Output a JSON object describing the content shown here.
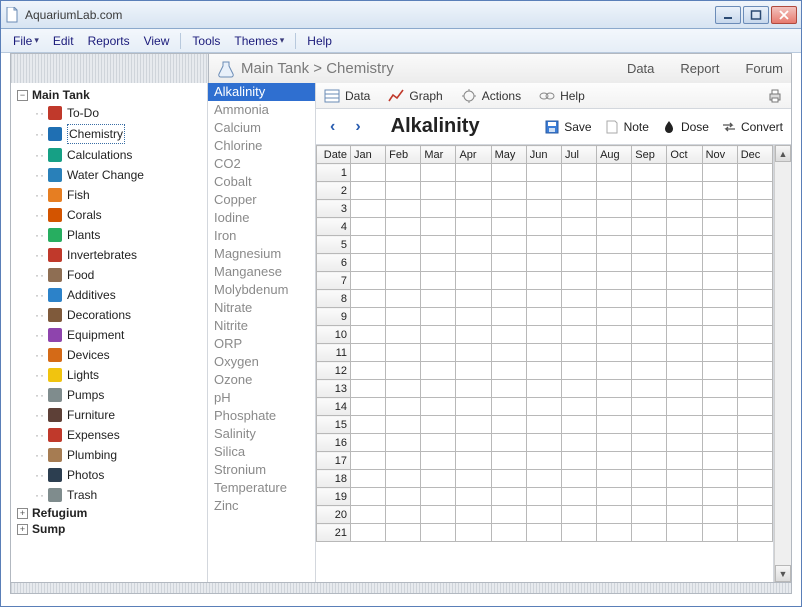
{
  "window": {
    "title": "AquariumLab.com"
  },
  "menubar": {
    "file": "File",
    "edit": "Edit",
    "reports": "Reports",
    "view": "View",
    "tools": "Tools",
    "themes": "Themes",
    "help": "Help"
  },
  "header": {
    "breadcrumb": "Main Tank > Chemistry",
    "links": {
      "data": "Data",
      "report": "Report",
      "forum": "Forum"
    }
  },
  "sidebar": {
    "tanks": [
      {
        "name": "Main Tank",
        "expanded": true
      },
      {
        "name": "Refugium",
        "expanded": false
      },
      {
        "name": "Sump",
        "expanded": false
      }
    ],
    "children": [
      "To-Do",
      "Chemistry",
      "Calculations",
      "Water Change",
      "Fish",
      "Corals",
      "Plants",
      "Invertebrates",
      "Food",
      "Additives",
      "Decorations",
      "Equipment",
      "Devices",
      "Lights",
      "Pumps",
      "Furniture",
      "Expenses",
      "Plumbing",
      "Photos",
      "Trash"
    ],
    "selected_child": "Chemistry"
  },
  "params": {
    "items": [
      "Alkalinity",
      "Ammonia",
      "Calcium",
      "Chlorine",
      "CO2",
      "Cobalt",
      "Copper",
      "Iodine",
      "Iron",
      "Magnesium",
      "Manganese",
      "Molybdenum",
      "Nitrate",
      "Nitrite",
      "ORP",
      "Oxygen",
      "Ozone",
      "pH",
      "Phosphate",
      "Salinity",
      "Silica",
      "Stronium",
      "Temperature",
      "Zinc"
    ],
    "selected": "Alkalinity"
  },
  "toolbar": {
    "data": "Data",
    "graph": "Graph",
    "actions": "Actions",
    "help": "Help"
  },
  "titlebar2": {
    "title": "Alkalinity",
    "save": "Save",
    "note": "Note",
    "dose": "Dose",
    "convert": "Convert"
  },
  "grid": {
    "headers": [
      "Date",
      "Jan",
      "Feb",
      "Mar",
      "Apr",
      "May",
      "Jun",
      "Jul",
      "Aug",
      "Sep",
      "Oct",
      "Nov",
      "Dec"
    ],
    "row_start": 1,
    "row_end": 21
  },
  "icons": {
    "tree": {
      "To-Do": "#c0392b",
      "Chemistry": "#1f6fb3",
      "Calculations": "#16a085",
      "Water Change": "#2980b9",
      "Fish": "#e67e22",
      "Corals": "#d35400",
      "Plants": "#27ae60",
      "Invertebrates": "#c0392b",
      "Food": "#8e6e53",
      "Additives": "#2c82c9",
      "Decorations": "#7f5a3b",
      "Equipment": "#8e44ad",
      "Devices": "#d46a17",
      "Lights": "#f1c40f",
      "Pumps": "#7f8c8d",
      "Furniture": "#5d4037",
      "Expenses": "#c0392b",
      "Plumbing": "#a67c52",
      "Photos": "#2c3e50",
      "Trash": "#7f8c8d"
    }
  }
}
